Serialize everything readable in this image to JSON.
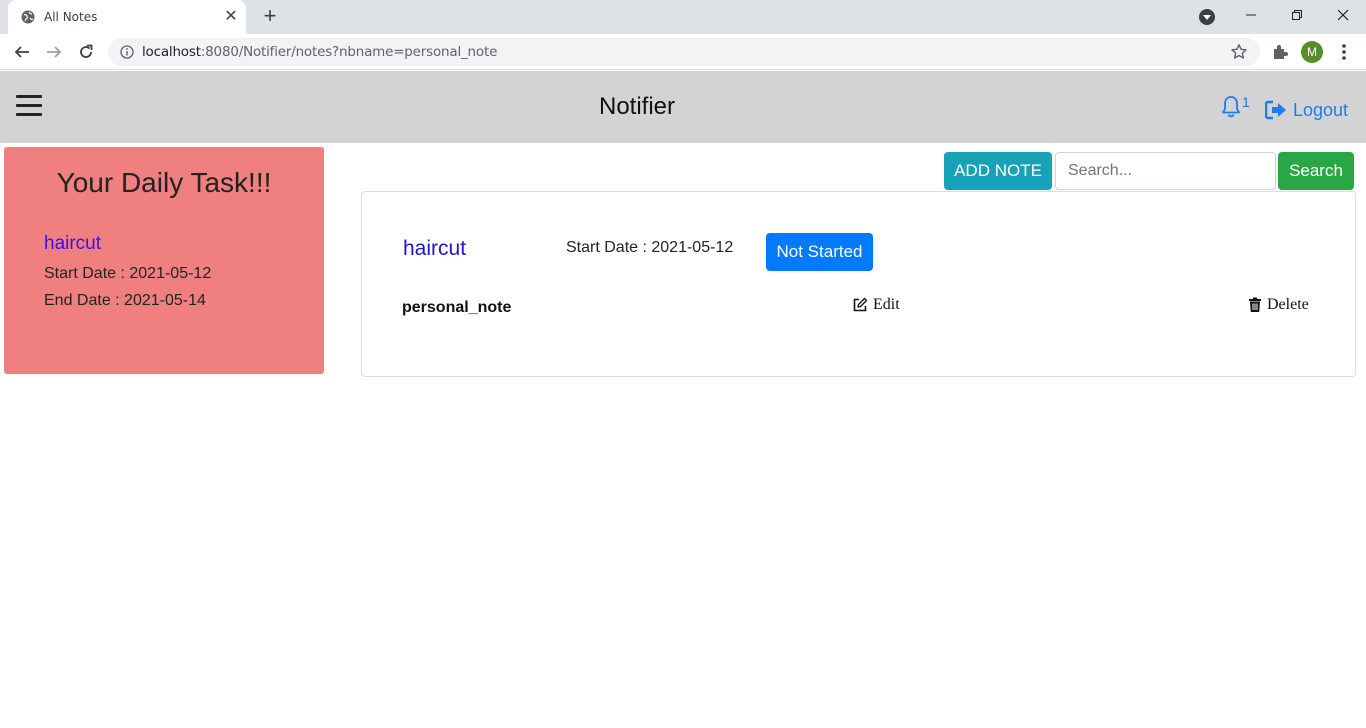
{
  "browser": {
    "tab_title": "All Notes",
    "url_host": "localhost",
    "url_rest": ":8080/Notifier/notes?nbname=personal_note",
    "avatar_letter": "M"
  },
  "header": {
    "title": "Notifier",
    "notification_count": "1",
    "logout_label": "Logout"
  },
  "daily": {
    "title": "Your Daily Task!!!",
    "task_name": "haircut",
    "start_date": "Start Date : 2021-05-12",
    "end_date": "End Date : 2021-05-14"
  },
  "actions": {
    "add_note_label": "ADD NOTE",
    "search_placeholder": "Search...",
    "search_label": "Search"
  },
  "note": {
    "title": "haircut",
    "start_date": "Start Date : 2021-05-12",
    "status": "Not Started",
    "notebook": "personal_note",
    "edit_label": "Edit",
    "delete_label": "Delete"
  },
  "colors": {
    "daily_bg": "#f08080",
    "add_note": "#17a2b8",
    "search": "#28a745",
    "status": "#007bff",
    "link": "#1e7cf2"
  }
}
